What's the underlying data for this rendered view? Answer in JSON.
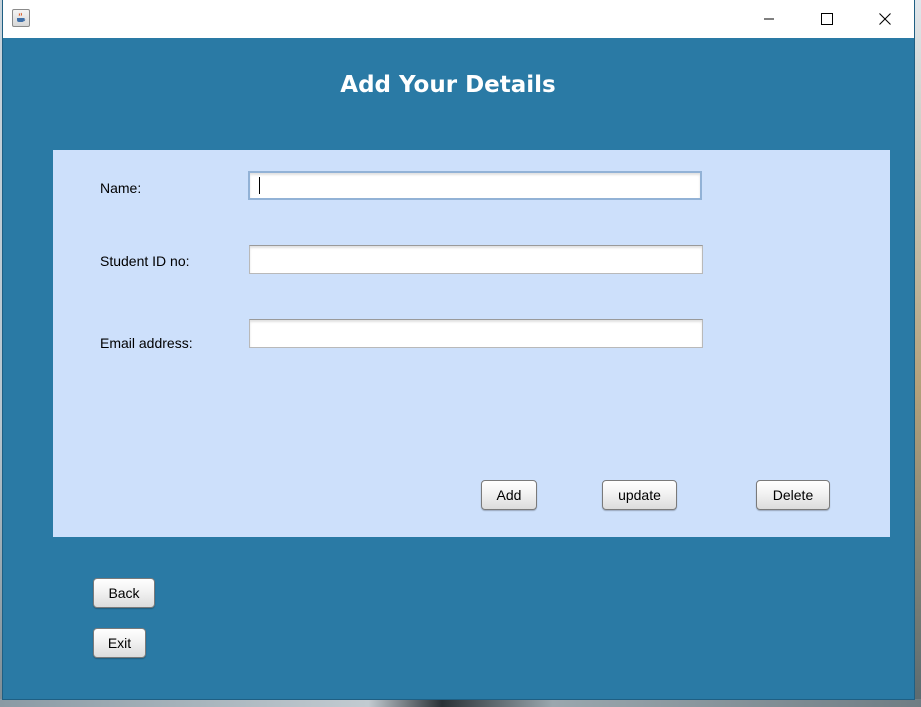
{
  "window": {
    "controls": {
      "minimize_icon": "minimize-icon",
      "maximize_icon": "maximize-icon",
      "close_icon": "close-icon"
    },
    "app_icon": "java-cup-icon"
  },
  "header": {
    "title": "Add Your Details"
  },
  "form": {
    "fields": [
      {
        "label": "Name:",
        "value": "",
        "placeholder": ""
      },
      {
        "label": "Student ID no:",
        "value": "",
        "placeholder": ""
      },
      {
        "label": "Email address:",
        "value": "",
        "placeholder": ""
      }
    ],
    "actions": {
      "add": "Add",
      "update": "update",
      "delete": "Delete"
    }
  },
  "footer": {
    "back": "Back",
    "exit": "Exit"
  },
  "colors": {
    "window_background": "#2a7aa5",
    "panel_background": "#cde0fb",
    "heading_text": "#ffffff"
  }
}
